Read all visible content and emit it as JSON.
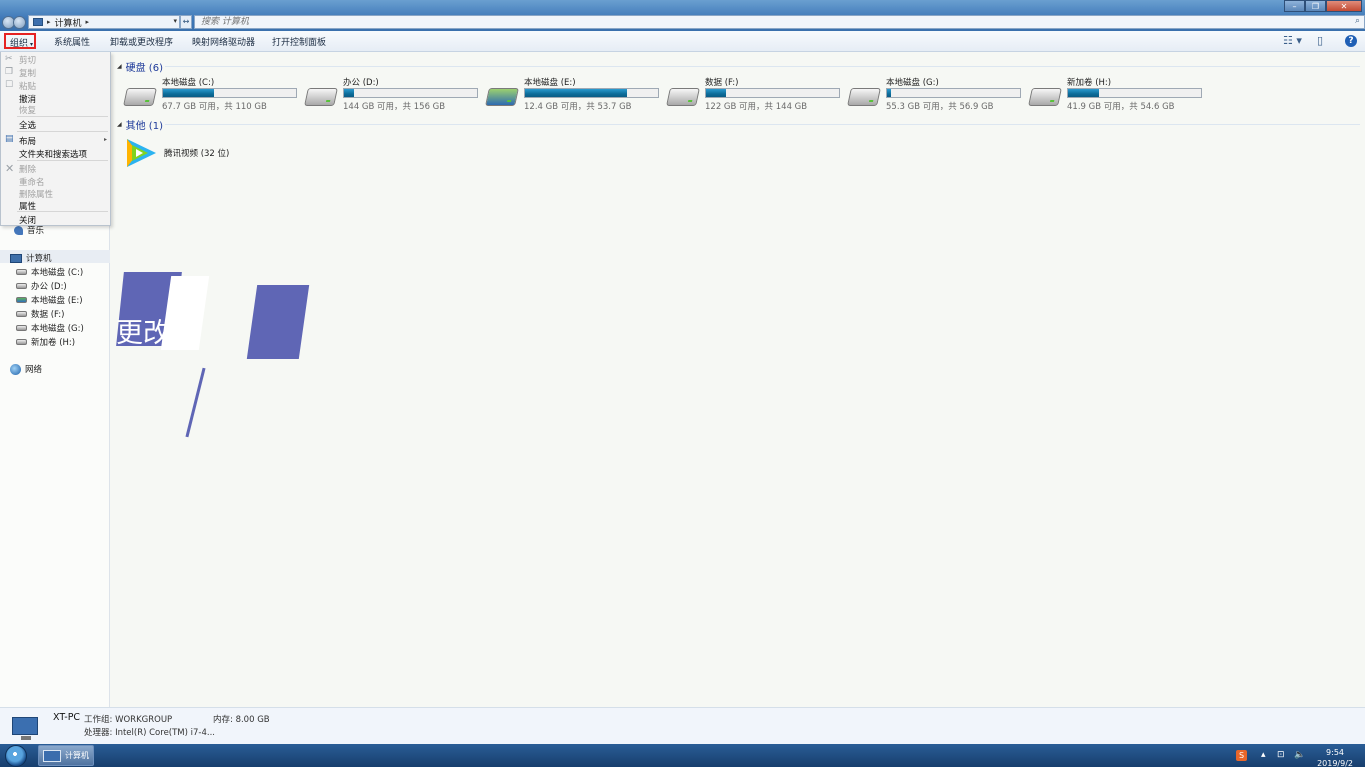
{
  "window": {
    "address": {
      "crumb": "计算机"
    },
    "search_placeholder": "搜索 计算机",
    "controls": {
      "minimize": "–",
      "maximize": "❐",
      "close": "✕"
    }
  },
  "toolbar": {
    "organize": "组织",
    "items": [
      "系统属性",
      "卸载或更改程序",
      "映射网络驱动器",
      "打开控制面板"
    ]
  },
  "menu": {
    "items": [
      {
        "label": "剪切",
        "enabled": false
      },
      {
        "label": "复制",
        "enabled": false
      },
      {
        "label": "粘贴",
        "enabled": false
      },
      {
        "label": "撤消",
        "enabled": true
      },
      {
        "label": "恢复",
        "enabled": false
      },
      {
        "label": "全选",
        "enabled": true
      },
      {
        "label": "布局",
        "enabled": true,
        "submenu": true
      },
      {
        "label": "文件夹和搜索选项",
        "enabled": true
      },
      {
        "label": "删除",
        "enabled": false
      },
      {
        "label": "重命名",
        "enabled": false
      },
      {
        "label": "删除属性",
        "enabled": false
      },
      {
        "label": "属性",
        "enabled": true
      },
      {
        "label": "关闭",
        "enabled": true
      }
    ]
  },
  "navpane": {
    "music": "音乐",
    "computer": "计算机",
    "drives": [
      "本地磁盘 (C:)",
      "办公 (D:)",
      "本地磁盘 (E:)",
      "数据 (F:)",
      "本地磁盘 (G:)",
      "新加卷 (H:)"
    ],
    "network": "网络"
  },
  "content": {
    "hard_disks_header": "硬盘 (6)",
    "drives": [
      {
        "name": "本地磁盘 (C:)",
        "free_text": "67.7 GB 可用，共 110 GB",
        "used_fraction": 0.385,
        "system": false
      },
      {
        "name": "办公 (D:)",
        "free_text": "144 GB 可用，共 156 GB",
        "used_fraction": 0.077,
        "system": false
      },
      {
        "name": "本地磁盘 (E:)",
        "free_text": "12.4 GB 可用，共 53.7 GB",
        "used_fraction": 0.769,
        "system": true
      },
      {
        "name": "数据 (F:)",
        "free_text": "122 GB 可用，共 144 GB",
        "used_fraction": 0.153,
        "system": false
      },
      {
        "name": "本地磁盘 (G:)",
        "free_text": "55.3 GB 可用，共 56.9 GB",
        "used_fraction": 0.028,
        "system": false
      },
      {
        "name": "新加卷 (H:)",
        "free_text": "41.9 GB 可用，共 54.6 GB",
        "used_fraction": 0.233,
        "system": false
      }
    ],
    "other_header": "其他 (1)",
    "apps": [
      {
        "name": "腾讯视频 (32 位)"
      }
    ]
  },
  "overlay": {
    "text": "更改"
  },
  "details": {
    "pc_name": "XT-PC",
    "workgroup_label": "工作组: WORKGROUP",
    "memory_label": "内存: 8.00 GB",
    "processor_label": "处理器: Intel(R) Core(TM) i7-4..."
  },
  "taskbar": {
    "active_task": "计算机",
    "clock_time": "9:54",
    "clock_date": "2019/9/2"
  },
  "colors": {
    "accent": "#1e3a9a",
    "highlight": "#e52222",
    "overlay": "#5f66b5",
    "bar_fill": "#0d6d9a"
  }
}
